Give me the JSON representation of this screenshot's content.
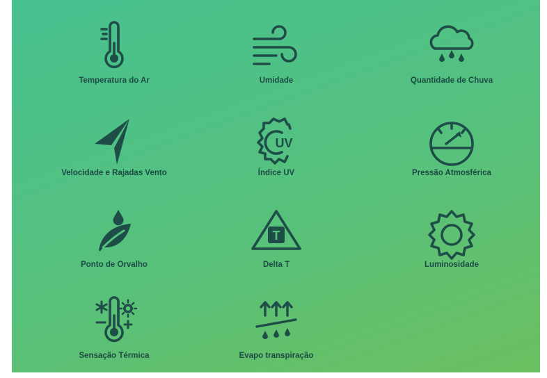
{
  "tiles": [
    {
      "label": "Temperatura do Ar",
      "icon": "thermometer-icon"
    },
    {
      "label": "Umidade",
      "icon": "wind-icon"
    },
    {
      "label": "Quantidade de Chuva",
      "icon": "rain-cloud-icon"
    },
    {
      "label": "Velocidade e Rajadas Vento",
      "icon": "navigation-arrow-icon"
    },
    {
      "label": "Índice UV",
      "icon": "uv-sun-icon"
    },
    {
      "label": "Pressão Atmosférica",
      "icon": "gauge-icon"
    },
    {
      "label": "Ponto de Orvalho",
      "icon": "leaf-drop-icon"
    },
    {
      "label": "Delta T",
      "icon": "delta-t-icon"
    },
    {
      "label": "Luminosidade",
      "icon": "sun-gear-icon"
    },
    {
      "label": "Sensação Térmica",
      "icon": "feels-like-icon"
    },
    {
      "label": "Evapo transpiração",
      "icon": "evapotranspiration-icon"
    }
  ],
  "uv_text": "UV",
  "delta_text": "T",
  "colors": {
    "gradient_start": "#47c190",
    "gradient_end": "#6bbf5f",
    "icon": "#1e4d47",
    "text": "#1c4a44"
  }
}
